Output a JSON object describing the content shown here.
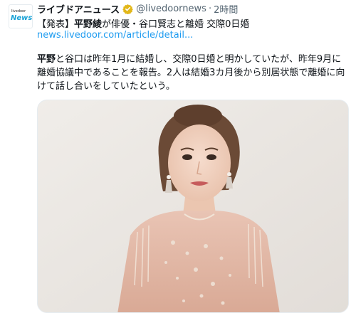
{
  "tweet": {
    "author_name": "ライブドアニュース",
    "handle": "@livedoornews",
    "separator": "·",
    "time": "2時間",
    "avatar_text_small": "livedoor",
    "avatar_text_big": "News",
    "headline_prefix": "【発表】",
    "headline_bold": "平野綾",
    "headline_rest": "が俳優・谷口賢志と離婚 交際0日婚",
    "link": "news.livedoor.com/article/detail...",
    "body_bold": "平野",
    "body_rest": "と谷口は昨年1月に結婚し、交際0日婚と明かしていたが、昨年9月に離婚協議中であることを報告。2人は結婚3カ月後から別居状態で離婚に向けて話し合いをしていたという。"
  },
  "colors": {
    "link": "#1d9bf0",
    "verified_badge": "#e2b719",
    "secondary_text": "#536471"
  },
  "icons": {
    "verified": "verified-badge-icon",
    "avatar": "livedoor-news-logo"
  }
}
